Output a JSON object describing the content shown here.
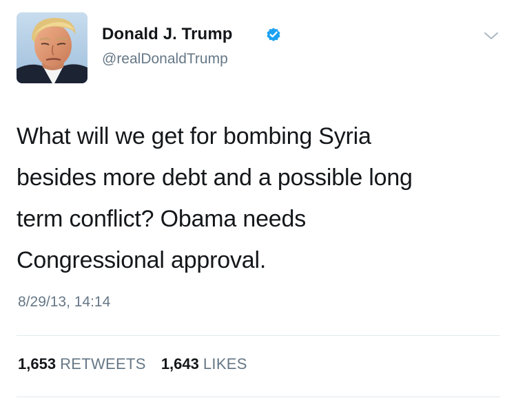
{
  "author": {
    "name": "Donald J. Trump",
    "handle": "@realDonaldTrump",
    "verified": true,
    "avatar_icon": "profile-photo"
  },
  "tweet": {
    "text": "What will we get for bombing Syria\nbesides more debt and a possible long\nterm conflict? Obama needs\nCongressional approval.",
    "timestamp": "8/29/13, 14:14"
  },
  "stats": {
    "retweets_count": "1,653",
    "retweets_label": "RETWEETS",
    "likes_count": "1,643",
    "likes_label": "LIKES"
  },
  "icons": {
    "verified": "verified-badge-icon",
    "menu": "chevron-down-icon"
  },
  "colors": {
    "text": "#14171a",
    "secondary": "#657786",
    "verified": "#1da1f2",
    "divider": "#e1e8ed"
  }
}
